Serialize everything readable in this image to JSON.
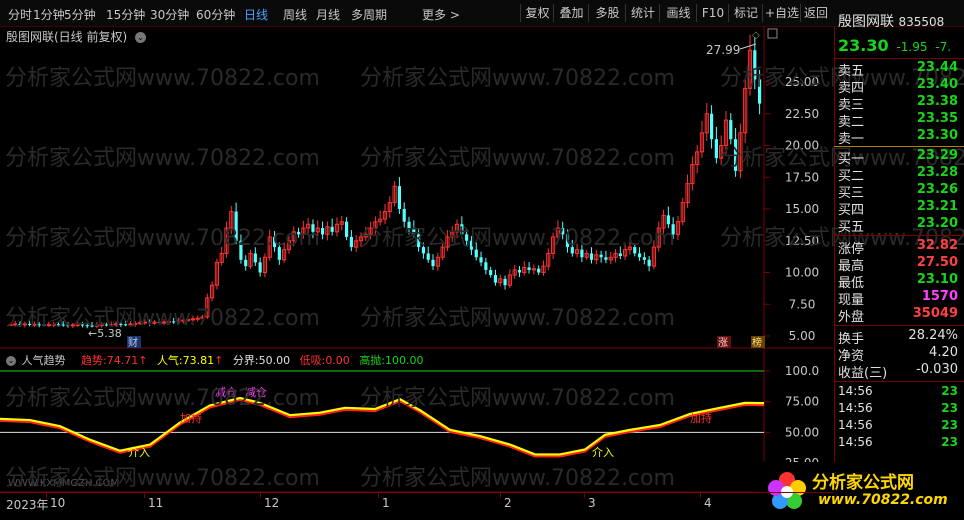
{
  "toolbar": {
    "periods": [
      "分时",
      "1分钟",
      "5分钟",
      "15分钟",
      "30分钟",
      "60分钟",
      "日线",
      "周线",
      "月线",
      "多周期",
      "更多 >"
    ],
    "active_period": "日线",
    "buttons": [
      "复权",
      "叠加",
      "多股",
      "统计",
      "画线",
      "F10",
      "标记",
      "+自选",
      "返回"
    ]
  },
  "chart": {
    "title": "殷图网联(日线 前复权)",
    "price_high_label": "27.99",
    "price_low_label": "5.38",
    "y_ticks": [
      "25.00",
      "22.50",
      "20.00",
      "17.50",
      "15.00",
      "12.50",
      "10.00",
      "7.50",
      "5.00"
    ],
    "markers": {
      "cai": "财",
      "zhang": "涨",
      "bang": "榜"
    }
  },
  "indicator": {
    "name": "人气趋势",
    "trend_label": "趋势:",
    "trend_value": "74.71",
    "pop_label": "人气:",
    "pop_value": "73.81",
    "bound_label": "分界:",
    "bound_value": "50.00",
    "low_label": "低吸:",
    "low_value": "0.00",
    "high_label": "高抛:",
    "high_value": "100.00",
    "y_ticks": [
      "100.0",
      "75.00",
      "50.00",
      "25.00"
    ],
    "annotations": [
      "介入",
      "加持",
      "减仓",
      "减仓",
      "介入",
      "加持"
    ]
  },
  "time_axis": [
    "2023年",
    "10",
    "11",
    "12",
    "1",
    "2",
    "3",
    "4"
  ],
  "watermark": "分析家公式网www.70822.com",
  "watermark_bottom": "WWW.KXMMGZH.COM",
  "right_panel": {
    "stock_name": "殷图网联",
    "stock_code": "835508",
    "price": "23.30",
    "change": "-1.95",
    "change_pct": "-7.",
    "asks": [
      {
        "label": "卖五",
        "price": "23.44"
      },
      {
        "label": "卖四",
        "price": "23.40"
      },
      {
        "label": "卖三",
        "price": "23.38"
      },
      {
        "label": "卖二",
        "price": "23.35"
      },
      {
        "label": "卖一",
        "price": "23.30"
      }
    ],
    "bids": [
      {
        "label": "买一",
        "price": "23.29"
      },
      {
        "label": "买二",
        "price": "23.28"
      },
      {
        "label": "买三",
        "price": "23.26"
      },
      {
        "label": "买四",
        "price": "23.21"
      },
      {
        "label": "买五",
        "price": "23.20"
      }
    ],
    "stats": [
      {
        "label": "涨停",
        "value": "32.82",
        "color": "red"
      },
      {
        "label": "最高",
        "value": "27.50",
        "color": "red"
      },
      {
        "label": "最低",
        "value": "23.10",
        "color": "green"
      },
      {
        "label": "现量",
        "value": "1570",
        "color": "magenta"
      },
      {
        "label": "外盘",
        "value": "35049",
        "color": "red"
      }
    ],
    "stats2": [
      {
        "label": "换手",
        "value": "28.24%",
        "color": "white"
      },
      {
        "label": "净资",
        "value": "4.20",
        "color": "white"
      },
      {
        "label": "收益(三)",
        "value": "-0.030",
        "color": "white"
      }
    ],
    "ticks": [
      {
        "time": "14:56",
        "price": "23"
      },
      {
        "time": "14:56",
        "price": "23"
      },
      {
        "time": "14:56",
        "price": "23"
      },
      {
        "time": "14:56",
        "price": "23"
      }
    ]
  },
  "logo": {
    "text": "分析家公式网",
    "url": "www.70822.com"
  },
  "colors": {
    "up": "#ff3232",
    "down": "#54ffff",
    "trend": "#ffff00",
    "pop": "#ff2020"
  }
}
